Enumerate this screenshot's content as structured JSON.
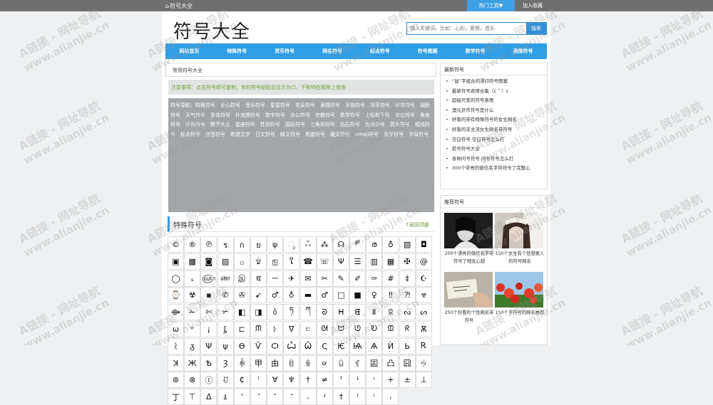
{
  "topbar": {
    "site": "符号大全",
    "hot_tools": "热门工具▼",
    "favorite": "加入收藏"
  },
  "logo": "符号大全",
  "search": {
    "placeholder": "输入关键词，比如：心形，爱情，音乐",
    "button": "搜索"
  },
  "nav": [
    "网站首页",
    "特殊符号",
    "货币符号",
    "网名符号",
    "标点符号",
    "符号图案",
    "数学符号",
    "表情符号"
  ],
  "breadcrumb": "常用符号大全",
  "notice": "注意事项：点击符号即可复制；有的符号粘贴后显示为口，不影响在昵称上使用",
  "symbol_nav_text": "符号导航：特殊符号　爱心符号　音乐符号　星星符号　花朵符号　表情符号　手指符号　货币符号　对错符号　翅膀符号　天气符号　集体符号　扑克牌符号　数字符号　办公符号　宗教符号　数学符号　上标和下标　单位符号　角度符号　环保符号　数学大全　星座符号　性别符号　国际符号　三角形符号　钻石符号　色块符号　箭头符号　框线符号　标点符号　拼音符号　希腊文字　日文符号　韩文符号　希腊符号　藏文符号　emoji符号　数学符号　字母符号",
  "section": {
    "title": "特殊符号",
    "back_top": "↑返回顶部"
  },
  "symbols": [
    "©",
    "®",
    "℗",
    "ร",
    "ก",
    "ย",
    "ψ",
    "ೃ",
    "ஃ",
    "⁂",
    "☊",
    "༗",
    "ര",
    "♁",
    "▧",
    "◘",
    "▣",
    "▩",
    "◙",
    "▨",
    "۞",
    "۩",
    "ஐ",
    "ໃ",
    "☎",
    "☏",
    "Ψ",
    "☰",
    "▥",
    "▦",
    "✠",
    "@",
    "◯",
    "ₛ",
    "௵",
    "ண",
    "இ",
    "ध",
    "⎓",
    "✈",
    "✉",
    "✂",
    "✎",
    "✐",
    "✑",
    "#",
    "‡",
    "☪",
    "⌚",
    "☢",
    "▪",
    "✆",
    "✇",
    "➹",
    "♂",
    "♁",
    "▬",
    "♂",
    "□",
    "■",
    "♀",
    "‼",
    "⁈",
    "☣",
    "⟴",
    "✁",
    "✄",
    "✃",
    "◧",
    "◨",
    "ბ",
    "ཏ",
    "ཀ",
    "ᘐ",
    "ᕼ",
    "ᘀ",
    "Ⅱ",
    "ꌋ",
    "ᔓ",
    "ᔕ",
    "ω",
    "ᵒ",
    "¡",
    "ᶋ",
    "⊏",
    "ᙏ",
    "ᚦ",
    "ᐁ",
    "ಲ",
    "ᘛ",
    "ᗢ",
    "ᘎ",
    "Ꭷ",
    "ᙢ",
    "ᖇ",
    "Ѫ",
    "ᚱ",
    "ᵹ",
    "Ψ",
    "ψ",
    "Ɵ",
    "Ѷ",
    "Ѻ",
    "Ѽ",
    "Ѿ",
    "Ҁ",
    "Ѥ",
    "Ѩ",
    "Ѧ",
    "Ѝ",
    "Ь",
    "Ꭱ",
    "ꓘ",
    "Ж",
    "Ѣ",
    "Ȝ",
    "ꊾ",
    "甲",
    "由",
    "ꊞ",
    "ꆜ",
    "ᏻ",
    "ꆰ",
    "ꁍ",
    "囸",
    "凸",
    "囧",
    "ꏢ",
    "⊚",
    "⊗",
    "Ⓘ",
    "ꀀ",
    "₵",
    "ꜝ",
    "∀",
    "♆",
    "†",
    "≠",
    "ꜛ",
    "ꜜ",
    "ꜞ",
    "+",
    "±",
    "⊥",
    "丁",
    "⊤",
    "ᐃ",
    "⍋",
    "ꜗ",
    "ꜘ",
    "ꜙ",
    "ꜚ",
    "ꜟ",
    "ꜜ",
    "†",
    "ꜝ",
    "ꜞ",
    "ꜟ"
  ],
  "sidebar": {
    "latest_title": "最新符号",
    "latest": [
      "“鼠”字组合的漂印符号图案",
      "最新符号表情合集（ε ˘̀ ）ε",
      "超级可爱的符号表情",
      "澳元货币符号是什么",
      "好看的带有特殊符号的女生网名",
      "好看的非主流女生网名带符号",
      "空白符号 空白符号怎么打",
      "箭号符号大全",
      "各种问号符号 问号符号怎么打",
      "300个带亮的微信名字带符号了完整心"
    ],
    "recommend_title": "推荐符号",
    "cards": [
      {
        "caption": "200个漂亮的微信名字带符号了理底心想"
      },
      {
        "caption": "150个女生有个性想要人的符号网名"
      },
      {
        "caption": "250个好看的个性网名带符号"
      },
      {
        "caption": "150个字符号的网名推荐"
      }
    ]
  },
  "watermark": {
    "line1": "A链接 - 网址导航",
    "line2": "www.alianjie.cn"
  }
}
